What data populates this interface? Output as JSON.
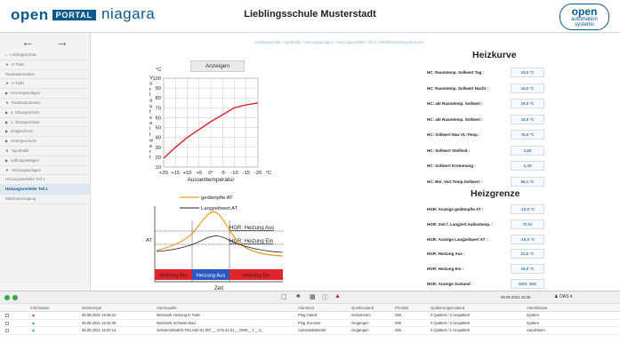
{
  "header": {
    "logo_open": "open",
    "logo_portal": "PORTAL",
    "niagara": "niagara",
    "niagara_sub": "Framework®",
    "title": "Lieblingsschule Musterstadt",
    "oas_big": "open",
    "oas_small1": "automation",
    "oas_small2": "systems"
  },
  "nav": {
    "back": "←",
    "forward": "→"
  },
  "sidebar": {
    "items": [
      {
        "label": "Lieblingsschule",
        "icon": "⌂",
        "active": false
      },
      {
        "label": "K-Trakt",
        "icon": "▼",
        "active": false
      },
      {
        "label": "Raumautomation",
        "icon": "",
        "active": false
      },
      {
        "label": "A-Trakt",
        "icon": "▼",
        "active": false
      },
      {
        "label": "Heizungsanlagen",
        "icon": "▶",
        "active": false
      },
      {
        "label": "Raumautomation",
        "icon": "▼",
        "active": false
      },
      {
        "label": "2. Obergeschoss",
        "icon": "▶",
        "active": false
      },
      {
        "label": "1. Obergeschoss",
        "icon": "▶",
        "active": false
      },
      {
        "label": "Erdgeschoss",
        "icon": "▶",
        "active": false
      },
      {
        "label": "Untergeschoss",
        "icon": "▶",
        "active": false
      },
      {
        "label": "Sporthalle",
        "icon": "▼",
        "active": false
      },
      {
        "label": "Lüftungsanlagen",
        "icon": "▶",
        "active": false
      },
      {
        "label": "Heizungsanlagen",
        "icon": "▼",
        "active": false
      },
      {
        "label": "Heizungsverteiler Teil 1",
        "icon": "",
        "active": false
      },
      {
        "label": "Heizungsverteiler Teil 2",
        "icon": "",
        "active": true
      },
      {
        "label": "Wärmeerzeugung",
        "icon": "",
        "active": false
      }
    ]
  },
  "breadcrumb": "Lieblingsschule  /  Sporthalle  /  Heizungsanlagen  /  Heizungsverteiler Teil 2  /  HKWEinstellungHeizkurve",
  "anzeigen_button": "Anzeigen",
  "chart_data": [
    {
      "type": "line",
      "title": "",
      "ylabel": "°C",
      "ylabel_vertical": "Vorlaufsollwert",
      "xlabel": "Aussentemperatur",
      "x_unit": "°C",
      "x_ticks": [
        "+20",
        "+15",
        "+10",
        "+5",
        "0°",
        "-5",
        "-10",
        "-15",
        "-20"
      ],
      "y_ticks": [
        10,
        20,
        30,
        40,
        50,
        60,
        70,
        80,
        90,
        100
      ],
      "ylim": [
        10,
        100
      ],
      "grid": true,
      "color": "#d9222b",
      "series": [
        {
          "x": [
            20,
            15,
            10,
            5,
            0,
            -5,
            -10,
            -15,
            -20
          ],
          "y": [
            19,
            30,
            40,
            48,
            56,
            63,
            70,
            73,
            75
          ]
        }
      ]
    },
    {
      "type": "line",
      "title": "",
      "xlabel": "Zeit",
      "y_label_left": "AT",
      "legend": [
        {
          "name": "gedämpfte AT",
          "color": "#f29b20"
        },
        {
          "name": "Langzeitwert AT",
          "color": "#222222"
        }
      ],
      "thresholds": [
        {
          "label": "HGR: Heizung Aus",
          "color": "#222222"
        },
        {
          "label": "HGR: Heizung Ein",
          "color": "#222222"
        }
      ],
      "bands": [
        {
          "label": "Heizung Ein",
          "color": "#e0242b"
        },
        {
          "label": "Heizung Aus",
          "color": "#2b59c3"
        },
        {
          "label": "Heizung Ein",
          "color": "#e0242b"
        }
      ]
    }
  ],
  "heizkurve": {
    "title": "Heizkurve",
    "rows": [
      {
        "label": "HC: Raumtemp. Sollwert Tag :",
        "value": "19,0 °C"
      },
      {
        "label": "HC: Raumtemp. Sollwert Nacht :",
        "value": "16,0 °C"
      },
      {
        "label": "HC: akt Raumtemp. Sollwert :",
        "value": "19,0 °C"
      },
      {
        "label": "HC: akt Raumtemp. Sollwert :",
        "value": "19,0 °C"
      },
      {
        "label": "HC: Sollwert Max VL-Temp :",
        "value": "75,0 °C"
      },
      {
        "label": "HC: Sollwert Steilheit :",
        "value": "1,60"
      },
      {
        "label": "HC: Sollwert Krümmung :",
        "value": "1,33"
      },
      {
        "label": "HC: Ber. Vorl.Temp.Sollwert :",
        "value": "66,1 °C"
      }
    ]
  },
  "heizgrenze": {
    "title": "Heizgrenze",
    "rows": [
      {
        "label": "HGR: Anzeige gedämpfte AT :",
        "value": "-10,0 °C"
      },
      {
        "label": "HGR: Zeit f. Langzeit Außentemp. :",
        "value": "72 hr"
      },
      {
        "label": "HGR: Anzeige Langzeitwert AT :",
        "value": "-10,0 °C"
      },
      {
        "label": "HGR: Heizung Aus :",
        "value": "21,0 °C"
      },
      {
        "label": "HGR: Heizung Ein :",
        "value": "16,0 °C"
      },
      {
        "label": "HGR: Anzeige Zustand :",
        "value": "HZG_EIN"
      }
    ]
  },
  "events": {
    "datetime": "09.08.2021 15:36",
    "user": "OAS",
    "columns": [
      "Information",
      "Zeitstempel",
      "Alarmquelle",
      "Alarmtext",
      "Quellzustand",
      "Priorität",
      "Quittierungszustand",
      "Alarmklasse"
    ],
    "rows": [
      {
        "status_color": "#e0242b",
        "time": "06.08.2021 19:39:10",
        "source": "Netzwerk Heizung K-Trakt",
        "text": "Ping Failed",
        "state": "Gekommen",
        "prio": "255",
        "ack": "0 Quittiert / 2 Unquittiert",
        "class": "System"
      },
      {
        "status_color": "#3aa64a",
        "time": "06.08.2021 16:44:35",
        "source": "Netzwerk Schwimmbad",
        "text": "Ping Success",
        "state": "Gegangen",
        "prio": "255",
        "ack": "0 Quittiert / 2 Unquittiert",
        "class": "System"
      },
      {
        "status_color": "#3aa64a",
        "time": "06.08.2021 16:07:14",
        "source": "Schwimmbad:RLT03.AS0.01.INT.__.SY5.41.01__.DMS__Y__U_",
        "text": "Automatikbetrieb",
        "state": "Gegangen",
        "prio": "255",
        "ack": "0 Quittiert / 1 Unquittiert",
        "class": "AandAlarm"
      }
    ]
  }
}
